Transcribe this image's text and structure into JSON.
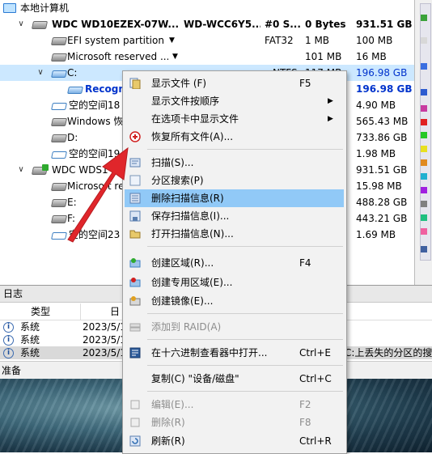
{
  "tree": {
    "root": {
      "label": "本地计算机"
    },
    "rows": [
      {
        "name": "WDC WD10EZEX-07W...",
        "col2": "WD-WCC6Y5...",
        "col3": "#0 S...",
        "col4": "0 Bytes",
        "col5": "931.51 GB"
      },
      {
        "name": "EFI system partition",
        "col3": "FAT32",
        "col4": "1 MB",
        "col5": "100 MB"
      },
      {
        "name": "Microsoft reserved ...",
        "col4": "101 MB",
        "col5": "16 MB"
      },
      {
        "name": "C:",
        "col3": "NTFS",
        "col4": "117 MB",
        "col5": "196.98 GB"
      },
      {
        "name": "Recogni",
        "col5": "196.98 GB"
      },
      {
        "name": "空的空间18",
        "col5": "4.90 MB"
      },
      {
        "name": "Windows 恢",
        "col5": "565.43 MB"
      },
      {
        "name": "D:",
        "col5": "733.86 GB"
      },
      {
        "name": "空的空间19",
        "col5": "1.98 MB"
      },
      {
        "name": "WDC WDS1",
        "col5": "931.51 GB"
      },
      {
        "name": "Microsoft re",
        "col5": "15.98 MB"
      },
      {
        "name": "E:",
        "col5": "488.28 GB"
      },
      {
        "name": "F:",
        "col5": "443.21 GB"
      },
      {
        "name": "空的空间23",
        "col5": "1.69 MB"
      }
    ]
  },
  "log": {
    "title": "日志",
    "headers": {
      "type": "类型",
      "date": "日"
    },
    "rows": [
      {
        "type": "系统",
        "date": "2023/5/1"
      },
      {
        "type": "系统",
        "date": "2023/5/1"
      },
      {
        "type": "系统",
        "date": "2023/5/1",
        "msg": "C:上丢失的分区的搜索"
      }
    ]
  },
  "status": {
    "text": "准备"
  },
  "menu": {
    "items": [
      {
        "label": "显示文件 (F)",
        "shortcut": "F5"
      },
      {
        "label": "显示文件按顺序",
        "submenu": "▶"
      },
      {
        "label": "在选项卡中显示文件",
        "submenu": "▶"
      },
      {
        "label": "恢复所有文件(A)..."
      },
      {
        "label": "扫描(S)..."
      },
      {
        "label": "分区搜索(P)"
      },
      {
        "label": "删除扫描信息(R)"
      },
      {
        "label": "保存扫描信息(I)..."
      },
      {
        "label": "打开扫描信息(N)..."
      },
      {
        "label": "创建区域(R)...",
        "shortcut": "F4"
      },
      {
        "label": "创建专用区域(E)..."
      },
      {
        "label": "创建镜像(E)..."
      },
      {
        "label": "添加到 RAID(A)"
      },
      {
        "label": "在十六进制查看器中打开...",
        "shortcut": "Ctrl+E"
      },
      {
        "label": "复制(C) \"设备/磁盘\"",
        "shortcut": "Ctrl+C"
      },
      {
        "label": "编辑(E)...",
        "shortcut": "F2"
      },
      {
        "label": "删除(R)",
        "shortcut": "F8"
      },
      {
        "label": "刷新(R)",
        "shortcut": "Ctrl+R"
      }
    ]
  },
  "colors": {
    "selection": "#cce8ff",
    "menu_highlight": "#91c9f7",
    "arrow": "#e0262b",
    "link_blue": "#0033cc"
  }
}
